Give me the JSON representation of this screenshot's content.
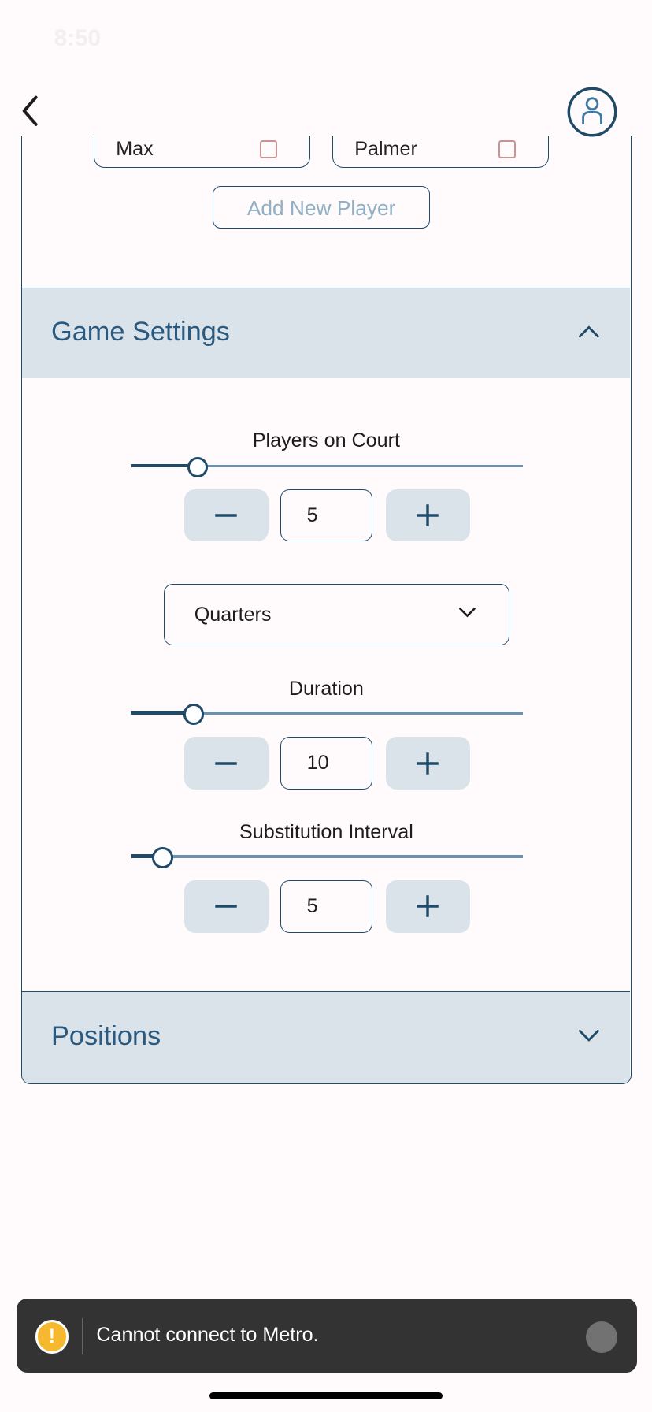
{
  "status_bar": {
    "time": "8:50"
  },
  "header": {
    "back_icon": "chevron-left-icon",
    "profile_icon": "user-circle-icon"
  },
  "players": {
    "items": [
      {
        "name": "Max"
      },
      {
        "name": "Palmer"
      }
    ],
    "add_label": "Add New Player"
  },
  "game_settings": {
    "title": "Game Settings",
    "expanded": true,
    "players_on_court": {
      "label": "Players on Court",
      "value": "5",
      "slider_fraction": 0.17
    },
    "period": {
      "selected": "Quarters"
    },
    "duration": {
      "label": "Duration",
      "value": "10",
      "slider_fraction": 0.16
    },
    "substitution_interval": {
      "label": "Substitution Interval",
      "value": "5",
      "slider_fraction": 0.08
    }
  },
  "positions": {
    "title": "Positions",
    "expanded": false
  },
  "toast": {
    "message": "Cannot connect to Metro.",
    "icon": "warning-icon"
  },
  "colors": {
    "accent": "#1f4a68",
    "header_bg": "#dbe3ea",
    "title_text": "#2a5a80",
    "slider_inactive": "#6a91ad",
    "toast_bg": "#333333",
    "warning": "#f5b82e"
  }
}
